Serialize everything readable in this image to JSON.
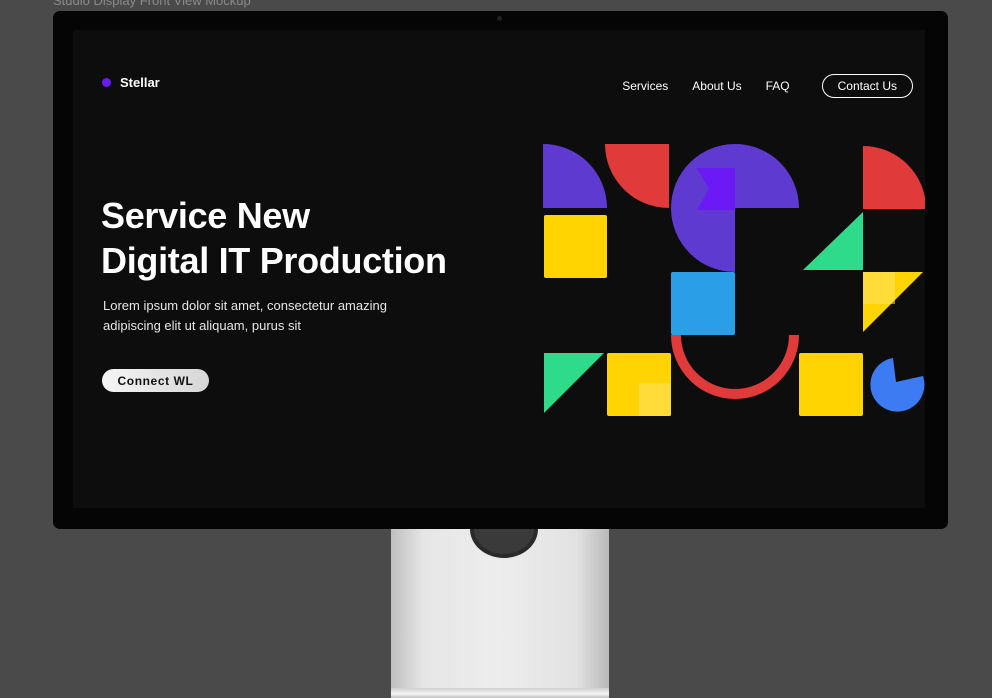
{
  "mockup": {
    "caption": "Studio Display Front View Mockup"
  },
  "nav": {
    "brand": "Stellar",
    "links": [
      "Services",
      "About Us",
      "FAQ"
    ],
    "cta": "Contact Us"
  },
  "hero": {
    "title_line1": "Service New",
    "title_line2": "Digital IT Production",
    "desc_line1": "Lorem ipsum dolor sit amet, consectetur amazing",
    "desc_line2": "adipiscing elit ut aliquam, purus sit",
    "button": "Connect  WL"
  },
  "colors": {
    "brand_dot": "#6a1cf6",
    "purple": "#5e3ad1",
    "red": "#e03a3a",
    "yellow": "#ffd400",
    "green": "#2edb8a",
    "blue": "#2a9fe8",
    "pie_blue": "#3d7bf2",
    "bright_purple": "#6b19f5"
  }
}
